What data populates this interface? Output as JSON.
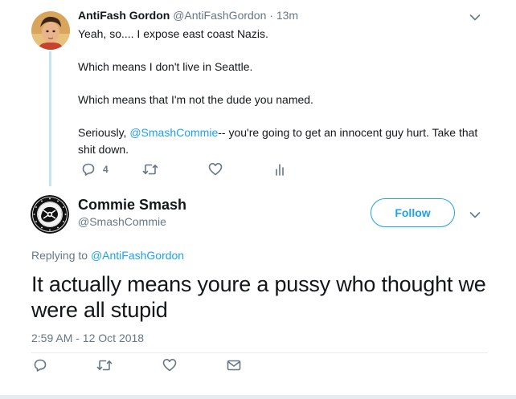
{
  "parent_tweet": {
    "name": "AntiFash Gordon",
    "handle": "@AntiFashGordon",
    "separator": "·",
    "time": "13m",
    "paragraphs": [
      "Yeah, so.... I expose east coast Nazis.",
      "Which means I don't live in Seattle.",
      "Which means that I'm not the dude you named."
    ],
    "last_paragraph": {
      "prefix": "Seriously, ",
      "mention": "@SmashCommie",
      "suffix": "-- you're going to get an innocent guy hurt. Take that shit down."
    },
    "actions": {
      "reply_icon": "reply-icon",
      "reply_count": "4",
      "retweet_icon": "retweet-icon",
      "like_icon": "heart-icon",
      "analytics_icon": "analytics-icon"
    }
  },
  "focused_tweet": {
    "name": "Commie Smash",
    "handle": "@SmashCommie",
    "follow_label": "Follow",
    "replying_prefix": "Replying to ",
    "replying_to": "@AntiFashGordon",
    "text": "It actually means youre a pussy who thought we were all stupid",
    "timestamp": "2:59 AM - 12 Oct 2018",
    "actions": {
      "reply_icon": "reply-icon",
      "retweet_icon": "retweet-icon",
      "like_icon": "heart-icon",
      "dm_icon": "envelope-icon"
    }
  },
  "colors": {
    "accent": "#1da1f2",
    "secondary_text": "#657786",
    "thread_line": "#c4e3f6",
    "icon": "#657786"
  }
}
